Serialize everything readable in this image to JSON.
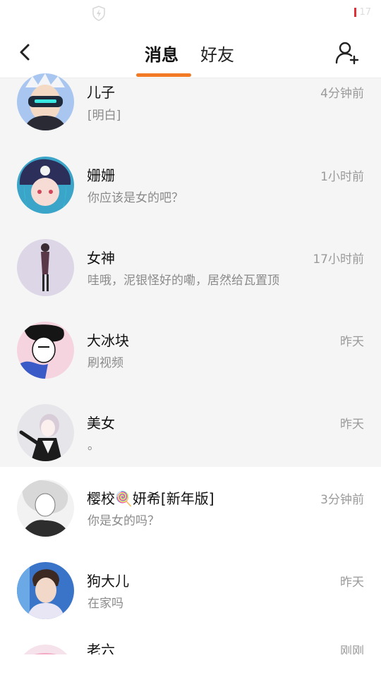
{
  "status_bar": {
    "battery_text": "17"
  },
  "header": {
    "tabs": [
      {
        "label": "消息",
        "active": true
      },
      {
        "label": "好友",
        "active": false
      }
    ],
    "accent_color": "#f37a24"
  },
  "conversations": [
    {
      "name": "儿子",
      "preview": "[明白]",
      "time": "4分钟前",
      "pinned": true
    },
    {
      "name": "姗姗",
      "preview": "你应该是女的吧？",
      "time": "1小时前",
      "pinned": true
    },
    {
      "name": "女神",
      "preview": "哇哦，泥银怪好的嘞，居然给瓦置顶",
      "time": "17小时前",
      "pinned": true
    },
    {
      "name": "大冰块",
      "preview": "刷视频",
      "time": "昨天",
      "pinned": true
    },
    {
      "name": "美女",
      "preview": "。",
      "time": "昨天",
      "pinned": true
    },
    {
      "name": "樱校🍭妍希[新年版]",
      "preview": "你是女的吗？",
      "time": "3分钟前",
      "pinned": false
    },
    {
      "name": "狗大儿",
      "preview": "在家吗",
      "time": "昨天",
      "pinned": false
    },
    {
      "name": "老六",
      "preview": "",
      "time": "刚刚",
      "pinned": false
    }
  ]
}
